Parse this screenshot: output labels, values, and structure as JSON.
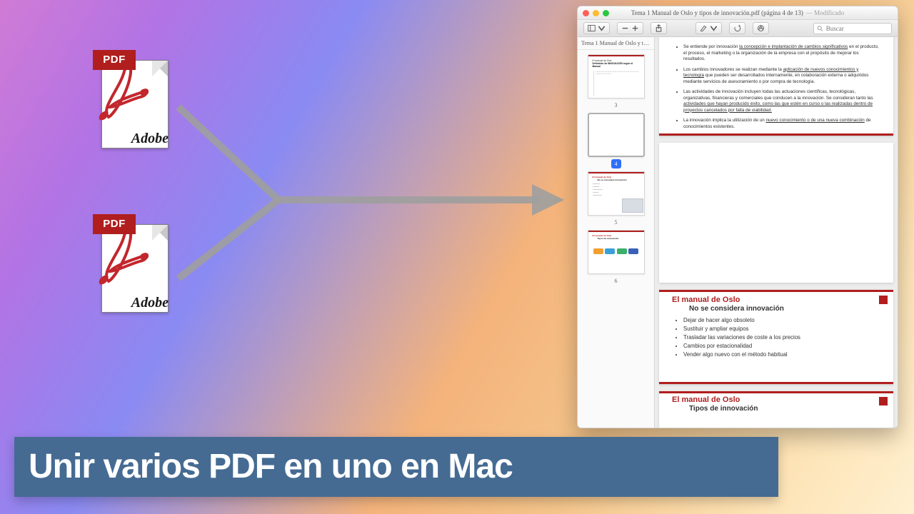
{
  "icons": {
    "pdf_badge": "PDF",
    "adobe_brand": "Adobe"
  },
  "caption": "Unir varios PDF en uno en Mac",
  "window": {
    "title": "Tema 1 Manual de Oslo y tipos de innovación.pdf (página 4 de 13)",
    "title_suffix": "— Modificado",
    "search_placeholder": "Buscar",
    "sidebar_title": "Tema 1 Manual de Oslo y tipos d…",
    "thumbs": [
      {
        "num": "3",
        "selected": false
      },
      {
        "num": "4",
        "selected": true
      },
      {
        "num": "5",
        "selected": false
      },
      {
        "num": "6",
        "selected": false
      }
    ],
    "page1_bullets": [
      {
        "pre": "Se entiende por innovación ",
        "u": "la concepción e implantación de cambios significativos",
        "post": " en el producto, el proceso, el marketing o la organización de la empresa con el propósito de mejorar los resultados."
      },
      {
        "pre": "Los cambios innovadores se realizan mediante la ",
        "u": "aplicación de nuevos conocimientos y tecnología",
        "post": " que pueden ser desarrollados internamente, en colaboración externa o adquiridos mediante servicios de asesoramiento o por compra de tecnología."
      },
      {
        "pre": "Las actividades de innovación incluyen todas las actuaciones científicas, tecnológicas, organizativas, financieras y comerciales que conducen a la innovación. Se consideran tanto las ",
        "u": "actividades que hayan producido éxito, como las que estén en curso o las realizadas dentro de proyectos cancelados por falta de viabilidad.",
        "post": ""
      },
      {
        "pre": "La innovación implica la utilización de un ",
        "u": "nuevo conocimiento o de una nueva combinación",
        "post": " de conocimientos existentes."
      }
    ],
    "page3": {
      "h1": "El manual de Oslo",
      "h2": "No se considera innovación",
      "items": [
        "Dejar de hacer algo obsoleto",
        "Sustituir y ampliar equipos",
        "Trasladar las variaciones de coste a los precios",
        "Cambios por estacionalidad",
        "Vender algo nuevo con el método habitual"
      ]
    },
    "page4": {
      "h1": "El manual de Oslo",
      "h2": "Tipos de innovación"
    }
  }
}
